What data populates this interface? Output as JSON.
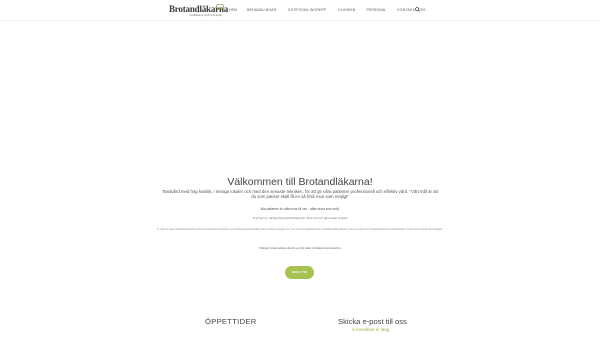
{
  "header": {
    "logo_text": "Brotandläkarna",
    "logo_subtitle": "Tandläkarna på Brommaplan",
    "nav": [
      "Hem",
      "Behandlingar",
      "Estetiska Ingrepp",
      "Kliniken",
      "Personal",
      "Kontakta oss"
    ],
    "search_icon": "search-icon"
  },
  "welcome": {
    "title": "Välkommen till Brotandläkarna!",
    "intro": "Tandvård med hög kvalité, i trivsiga lokaler och med den senaste tekniken, för att ge våra patienter professionell och effektiv vård. \"Vårt mål är att du som patient skall få en så frisk mun som möjligt\"",
    "patients_line": "Alla patienter är välkomna till oss - både stora som små.",
    "price_line": "Vi prisar ej, vänligt följ tandvårdsbud för 2024 och och gärna lika bemöta",
    "insurance_text": "Vi utför all slags tandvårdsbehandling såsom konventionell tandvård, som tandlossningsbehandling samt estetiska ingrepp och vi har även bra hjälpmedel för tandvårdsrädda patienter och är ansluten till Försäkringskassans tandvårdsstöd. Vi kan även erbjuda avbetalningar.",
    "notice_text": "Vänligen avboka/omboka din tid i god tid, minst 24 timmar innan bokad tid.",
    "button_label": "Boka tid"
  },
  "bottom": {
    "hours_title": "ÖPPETTIDER",
    "email_title": "Skicka e-post till oss",
    "email_sub": "vi kontaktar er idag"
  },
  "colors": {
    "accent": "#a7c24f",
    "accent_text": "#9ab83e",
    "heading": "#444444"
  }
}
